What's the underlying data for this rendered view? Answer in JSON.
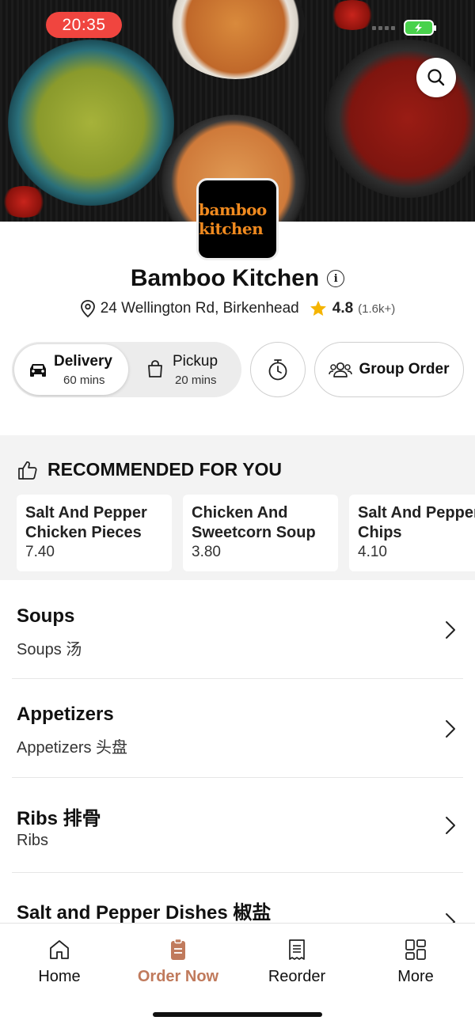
{
  "status_bar": {
    "time": "20:35"
  },
  "restaurant": {
    "logo_text": "bamboo kitchen",
    "name": "Bamboo Kitchen",
    "address": "24 Wellington Rd, Birkenhead",
    "rating": "4.8",
    "rating_count": "(1.6k+)"
  },
  "order_mode": {
    "delivery": {
      "label": "Delivery",
      "time": "60 mins",
      "selected": true
    },
    "pickup": {
      "label": "Pickup",
      "time": "20 mins",
      "selected": false
    },
    "group_order_label": "Group Order"
  },
  "recommended": {
    "header": "RECOMMENDED FOR YOU",
    "items": [
      {
        "name_line1": "Salt And Pepper",
        "name_line2": "Chicken Pieces",
        "price": "7.40"
      },
      {
        "name_line1": "Chicken And",
        "name_line2": "Sweetcorn Soup",
        "price": "3.80"
      },
      {
        "name_line1": "Salt And Pepper",
        "name_line2": "Chips",
        "price": "4.10"
      }
    ]
  },
  "categories": [
    {
      "title": "Soups",
      "subtitle": "Soups 汤"
    },
    {
      "title": "Appetizers",
      "subtitle": "Appetizers 头盘"
    },
    {
      "title": "Ribs 排骨",
      "subtitle": "Ribs"
    },
    {
      "title": "Salt and Pepper Dishes 椒盐",
      "subtitle": ""
    }
  ],
  "tabbar": {
    "items": [
      {
        "label": "Home",
        "icon": "home-icon",
        "active": false
      },
      {
        "label": "Order Now",
        "icon": "order-icon",
        "active": true
      },
      {
        "label": "Reorder",
        "icon": "receipt-icon",
        "active": false
      },
      {
        "label": "More",
        "icon": "grid-icon",
        "active": false
      }
    ]
  },
  "colors": {
    "accent": "#c07a5c",
    "status_time_bg": "#f0453f",
    "star": "#f5b400",
    "logo_text": "#f08a1f"
  }
}
